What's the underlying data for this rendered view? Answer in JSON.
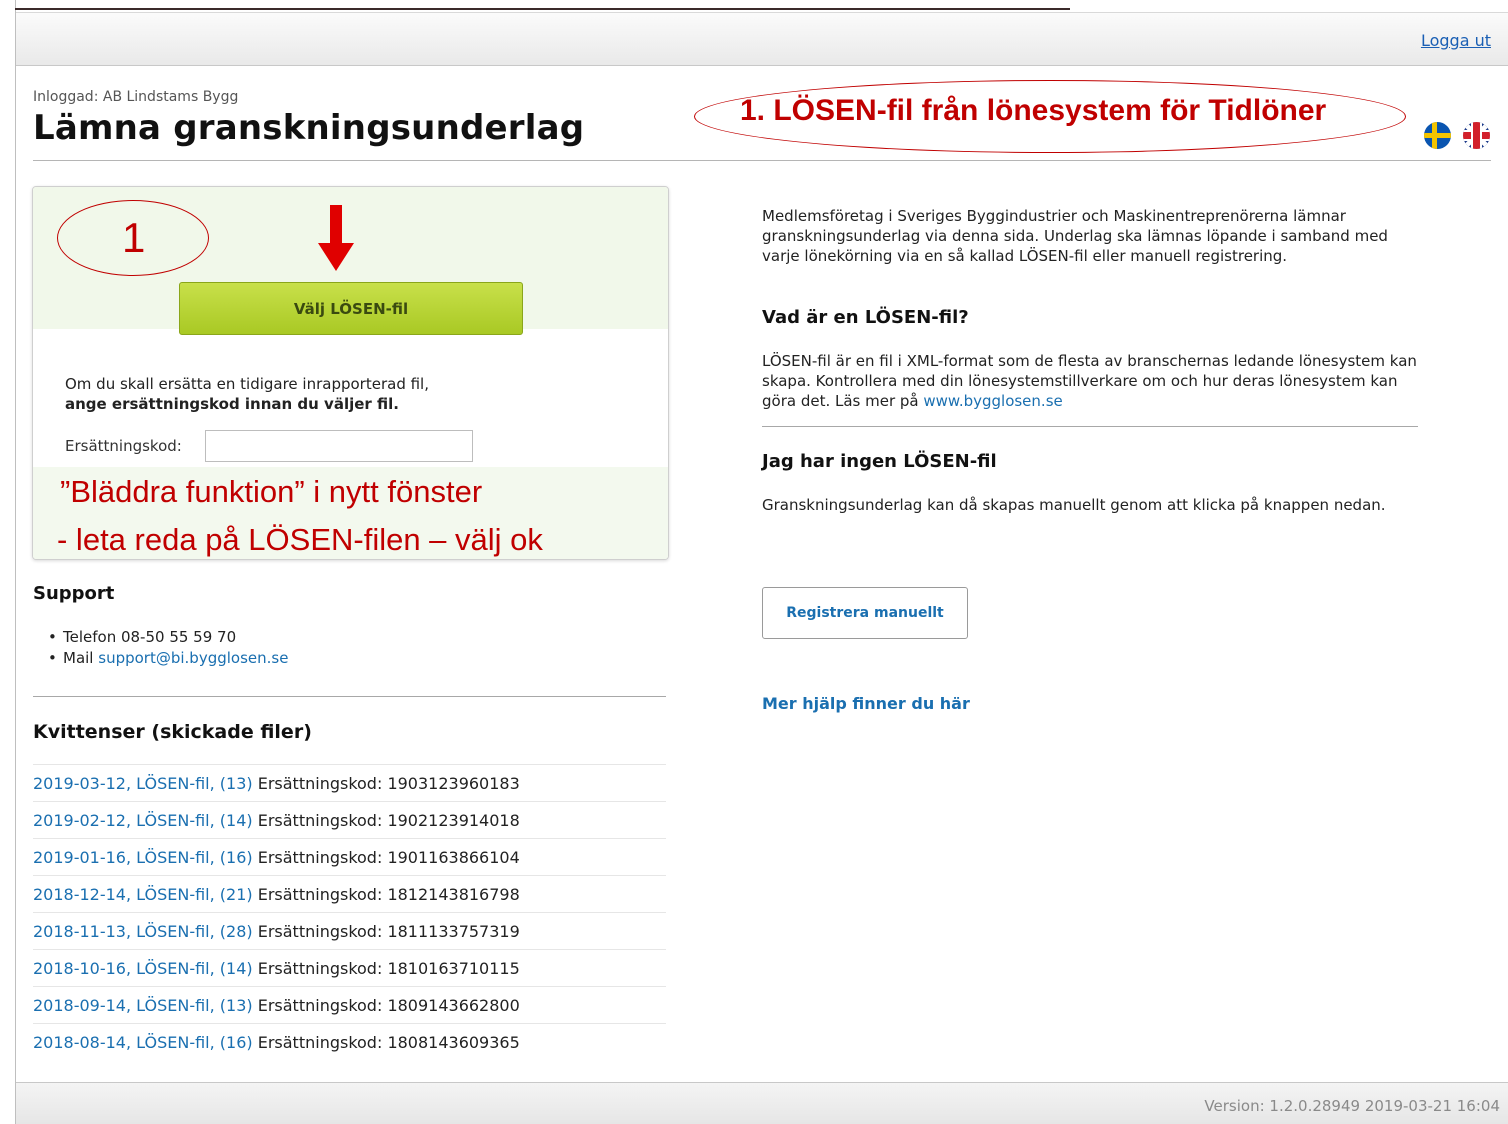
{
  "header": {
    "logout_label": "Logga ut"
  },
  "page": {
    "logged_in": "Inloggad: AB Lindstams Bygg",
    "title": "Lämna granskningsunderlag"
  },
  "annotations": {
    "top_note": "1. LÖSEN-fil från lönesystem för Tidlöner",
    "step_number": "1",
    "browse_line1": "”Bläddra funktion” i nytt fönster",
    "browse_line2": "- leta reda på LÖSEN-filen – välj ok",
    "color": "#c00000"
  },
  "flags": [
    "sweden-flag-icon",
    "uk-flag-icon"
  ],
  "upload": {
    "select_button_label": "Välj LÖSEN-fil",
    "replace_text": "Om du skall ersätta en tidigare inrapporterad fil,",
    "replace_bold": "ange ersättningskod innan du väljer fil.",
    "code_label": "Ersättningskod:",
    "code_value": ""
  },
  "support": {
    "heading": "Support",
    "phone": "Telefon 08-50 55 59 70",
    "mail_prefix": "Mail ",
    "mail_link": "support@bi.bygglosen.se"
  },
  "receipts": {
    "heading": "Kvittenser (skickade filer)",
    "items": [
      {
        "link": "2019-03-12, LÖSEN-fil, (13)",
        "text": " Ersättningskod: 1903123960183"
      },
      {
        "link": "2019-02-12, LÖSEN-fil, (14)",
        "text": " Ersättningskod: 1902123914018"
      },
      {
        "link": "2019-01-16, LÖSEN-fil, (16)",
        "text": " Ersättningskod: 1901163866104"
      },
      {
        "link": "2018-12-14, LÖSEN-fil, (21)",
        "text": " Ersättningskod: 1812143816798"
      },
      {
        "link": "2018-11-13, LÖSEN-fil, (28)",
        "text": " Ersättningskod: 1811133757319"
      },
      {
        "link": "2018-10-16, LÖSEN-fil, (14)",
        "text": " Ersättningskod: 1810163710115"
      },
      {
        "link": "2018-09-14, LÖSEN-fil, (13)",
        "text": " Ersättningskod: 1809143662800"
      },
      {
        "link": "2018-08-14, LÖSEN-fil, (16)",
        "text": " Ersättningskod: 1808143609365"
      }
    ]
  },
  "info": {
    "intro": "Medlemsföretag i Sveriges Byggindustrier och Maskinentreprenörerna lämnar granskningsunderlag via denna sida. Underlag ska lämnas löpande i samband med varje lönekörning via en så kallad LÖSEN-fil eller manuell registrering.",
    "what_heading": "Vad är en LÖSEN-fil?",
    "what_text": "LÖSEN-fil är en fil i XML-format som de flesta av branschernas ledande lönesystem kan skapa. Kontrollera med din lönesystemstillverkare om och hur deras lönesystem kan göra det. Läs mer på ",
    "what_link": "www.bygglosen.se",
    "none_heading": "Jag har ingen LÖSEN-fil",
    "none_text": "Granskningsunderlag kan då skapas manuellt genom att klicka på knappen nedan.",
    "manual_button_label": "Registrera manuellt",
    "help_link": "Mer hjälp finner du här"
  },
  "footer": {
    "version": "Version: 1.2.0.28949 2019-03-21 16:04"
  }
}
